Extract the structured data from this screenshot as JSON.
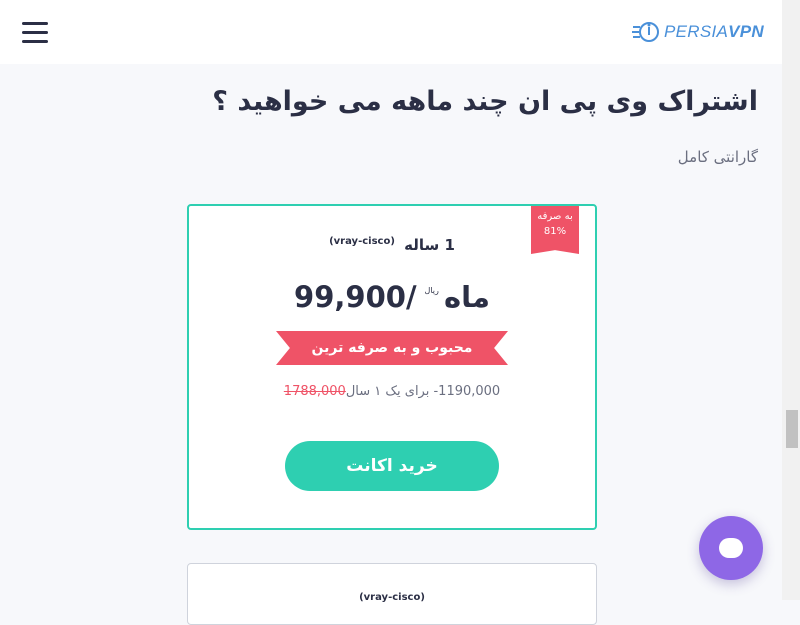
{
  "header": {
    "logo_prefix": "PERSIA",
    "logo_suffix": "VPN"
  },
  "page": {
    "title": "اشتراک وی پی ان چند ماهه می خواهید ؟",
    "subtitle": "گارانتی کامل"
  },
  "plans": [
    {
      "badge_line1": "به صرفه",
      "badge_line2": "81%",
      "duration": "1 ساله",
      "protocols": "(vray-cisco)",
      "currency": "ریال",
      "price": "99,900/ماه",
      "banner": "محبوب و به صرفه ترین",
      "old_price": "1788,000",
      "total_text": "1190,000- برای یک ۱ سال",
      "buy_label": "خرید اکانت"
    },
    {
      "protocols": "(vray-cisco)"
    }
  ],
  "colors": {
    "accent": "#2ecfb1",
    "badge": "#ef5367",
    "chat": "#8e67e6",
    "logo": "#4a90d9"
  },
  "icons": {
    "menu": "hamburger-menu-icon",
    "logo": "persiavpn-logo-icon",
    "chat": "chat-bubble-icon"
  }
}
